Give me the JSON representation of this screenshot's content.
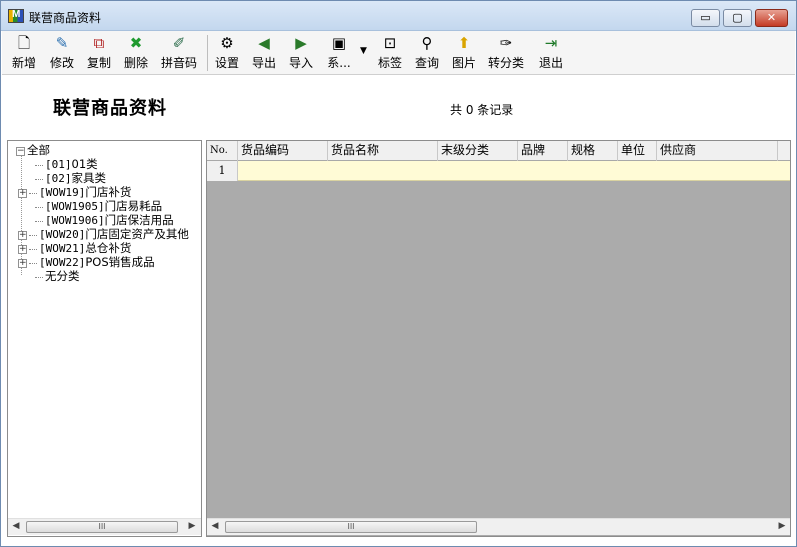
{
  "window": {
    "title": "联营商品资料",
    "icon_name": "app-logo-icon",
    "icon_letter": "M",
    "buttons": {
      "minimize": "▭",
      "maximize": "▢",
      "close": "✕"
    }
  },
  "toolbar": {
    "items": [
      {
        "label": "新增",
        "icon": "new-document-icon",
        "glyph": "🗋"
      },
      {
        "label": "修改",
        "icon": "edit-icon",
        "glyph": "✎"
      },
      {
        "label": "复制",
        "icon": "copy-icon",
        "glyph": "⧉"
      },
      {
        "label": "删除",
        "icon": "delete-x-icon",
        "glyph": "✖"
      },
      {
        "label": "拼音码",
        "icon": "pinyin-icon",
        "glyph": "✐"
      },
      {
        "label": "设置",
        "icon": "settings-icon",
        "glyph": "⚙"
      },
      {
        "label": "导出",
        "icon": "export-icon",
        "glyph": "◀"
      },
      {
        "label": "导入",
        "icon": "import-icon",
        "glyph": "▶"
      },
      {
        "label": "系...",
        "icon": "system-icon",
        "glyph": "▣"
      },
      {
        "label": "标签",
        "icon": "label-icon",
        "glyph": "⊡"
      },
      {
        "label": "查询",
        "icon": "binoculars-icon",
        "glyph": "⚲"
      },
      {
        "label": "图片",
        "icon": "picture-icon",
        "glyph": "⬆"
      },
      {
        "label": "转分类",
        "icon": "brush-icon",
        "glyph": "✑"
      },
      {
        "label": "退出",
        "icon": "exit-door-icon",
        "glyph": "⇥"
      }
    ],
    "dropdown_arrow": "▼"
  },
  "header": {
    "title": "联营商品资料",
    "record_count": "共 0 条记录"
  },
  "tree": {
    "root": "全部",
    "items": [
      {
        "code": "[01]",
        "name": "01类",
        "expandable": false
      },
      {
        "code": "[02]",
        "name": "家具类",
        "expandable": false
      },
      {
        "code": "[WOW19]",
        "name": "门店补货",
        "expandable": true
      },
      {
        "code": "[WOW1905]",
        "name": "门店易耗品",
        "expandable": false
      },
      {
        "code": "[WOW1906]",
        "name": "门店保洁用品",
        "expandable": false
      },
      {
        "code": "[WOW20]",
        "name": "门店固定资产及其他",
        "expandable": true
      },
      {
        "code": "[WOW21]",
        "name": "总仓补货",
        "expandable": true
      },
      {
        "code": "[WOW22]",
        "name": "POS销售成品",
        "expandable": true
      },
      {
        "code": "",
        "name": "无分类",
        "expandable": false
      }
    ]
  },
  "grid": {
    "columns": [
      "No.",
      "货品编码",
      "货品名称",
      "末级分类",
      "品牌",
      "规格",
      "单位",
      "供应商"
    ],
    "rows": [
      {
        "num": "1"
      }
    ]
  },
  "scrollbars": {
    "left_arrow": "◀",
    "right_arrow": "▶",
    "thumb_grip": "III"
  }
}
